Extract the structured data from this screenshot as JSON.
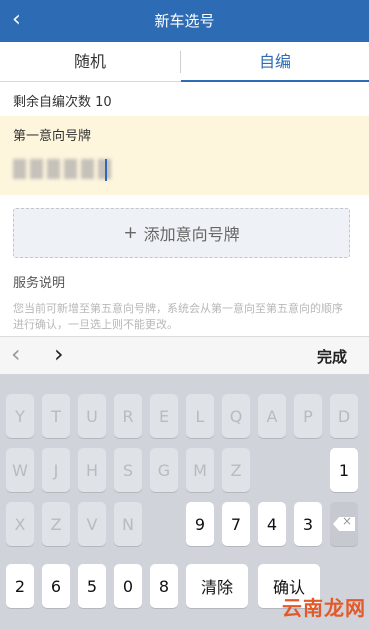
{
  "header": {
    "title": "新车选号",
    "back_glyph": "‹"
  },
  "tabs": [
    {
      "label": "随机",
      "selected": false
    },
    {
      "label": "自编",
      "selected": true
    }
  ],
  "remaining_text": "剩余自编次数 10",
  "first_choice": {
    "label": "第一意向号牌"
  },
  "add_button": {
    "plus": "+",
    "label": "添加意向号牌"
  },
  "service": {
    "title": "服务说明",
    "text": "您当前可新增至第五意向号牌，系统会从第一意向至第五意向的顺序进行确认，一旦选上则不能更改。"
  },
  "keyboard_toolbar": {
    "prev": "‹",
    "next": "›",
    "done": "完成"
  },
  "keyboard": {
    "row1": [
      "Y",
      "T",
      "U",
      "R",
      "E",
      "L",
      "Q",
      "A",
      "P",
      "D"
    ],
    "row2": [
      "W",
      "J",
      "H",
      "S",
      "G",
      "M",
      "Z",
      "1"
    ],
    "row3": [
      "X",
      "Z",
      "V",
      "N",
      "9",
      "7",
      "4",
      "3"
    ],
    "row4": [
      "2",
      "6",
      "5",
      "0",
      "8"
    ],
    "clear": "清除",
    "confirm": "确认"
  },
  "watermark": "云南龙网"
}
